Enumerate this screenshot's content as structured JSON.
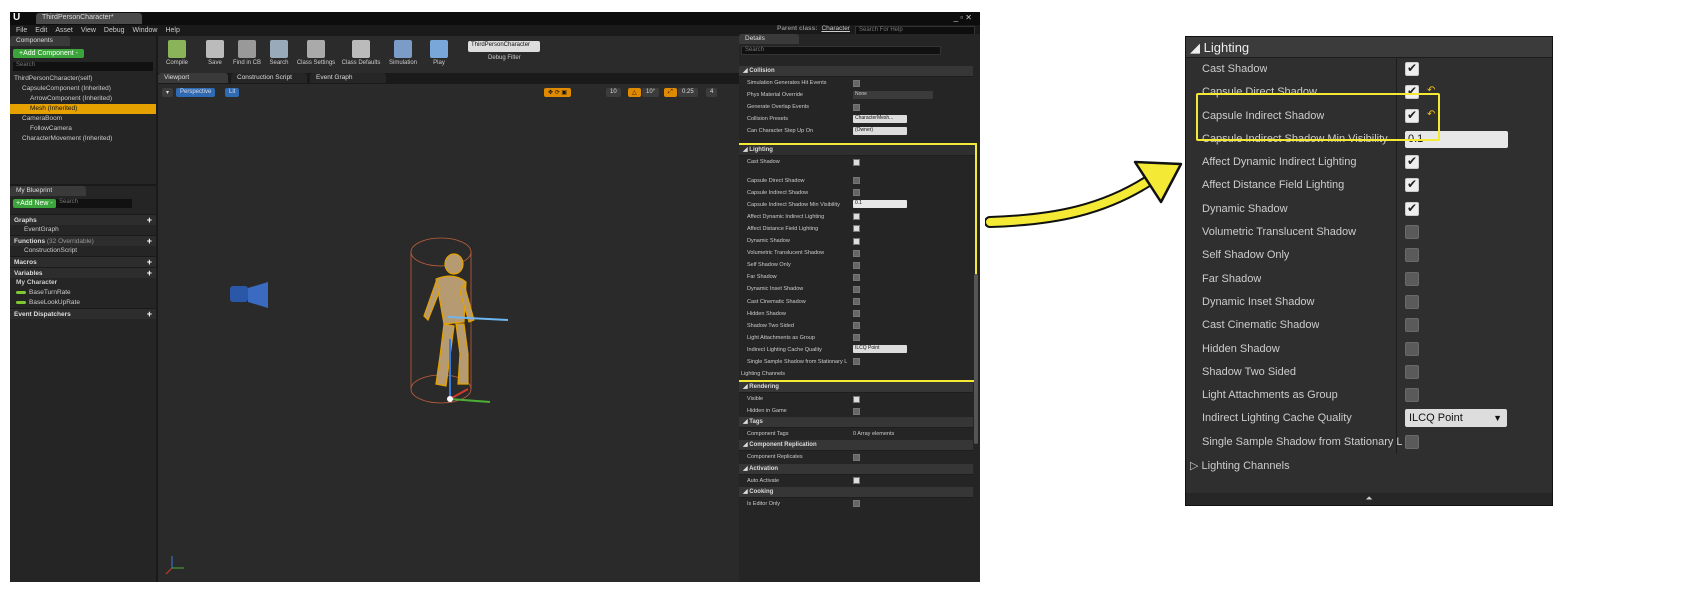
{
  "editor": {
    "logo": "U",
    "doc_tab": "ThirdPersonCharacter*",
    "menu": [
      "File",
      "Edit",
      "Asset",
      "View",
      "Debug",
      "Window",
      "Help"
    ],
    "parent_class_label": "Parent class:",
    "parent_class_value": "Character",
    "search_help_placeholder": "Search For Help"
  },
  "components": {
    "tab": "Components",
    "add_button": "+Add Component -",
    "search_placeholder": "Search",
    "tree": [
      {
        "label": "ThirdPersonCharacter(self)",
        "indent": 0
      },
      {
        "label": "CapsuleComponent (Inherited)",
        "indent": 1
      },
      {
        "label": "ArrowComponent (Inherited)",
        "indent": 2
      },
      {
        "label": "Mesh (Inherited)",
        "indent": 2,
        "selected": true
      },
      {
        "label": "CameraBoom",
        "indent": 1
      },
      {
        "label": "FollowCamera",
        "indent": 2
      },
      {
        "label": "CharacterMovement (Inherited)",
        "indent": 1
      }
    ]
  },
  "blueprint": {
    "tab": "My Blueprint",
    "add_button": "+Add New -",
    "search_placeholder": "Search",
    "graphs": "Graphs",
    "event_graph": "EventGraph",
    "functions": "Functions",
    "functions_note": "(32 Overridable)",
    "construction_script": "ConstructionScript",
    "macros": "Macros",
    "variables": "Variables",
    "my_character": "My Character",
    "var_1": "BaseTurnRate",
    "var_2": "BaseLookUpRate",
    "event_dispatchers": "Event Dispatchers"
  },
  "toolbar": {
    "compile": "Compile",
    "save": "Save",
    "find_in_cb": "Find in CB",
    "search": "Search",
    "class_settings": "Class Settings",
    "class_defaults": "Class Defaults",
    "simulation": "Simulation",
    "play": "Play",
    "debug_object": "ThirdPersonCharacter",
    "debug_filter": "Debug Filter"
  },
  "editor_tabs": [
    "Viewport",
    "Construction Script",
    "Event Graph"
  ],
  "viewport": {
    "perspective": "Perspective",
    "lit": "Lit",
    "grid_snap": "10",
    "rot_snap": "10°",
    "scale_snap": "0.25",
    "cam_speed": "4"
  },
  "details": {
    "tab": "Details",
    "search_placeholder": "Search",
    "collision": {
      "header": "Collision",
      "sim_hit_events": "Simulation Generates Hit Events",
      "phys_material": "Phys Material Override",
      "phys_value": "None",
      "overlap_events": "Generate Overlap Events",
      "presets": "Collision Presets",
      "presets_value": "CharacterMesh...",
      "step_up": "Can Character Step Up On",
      "step_up_value": "(Owner)"
    },
    "lighting_header": "Lighting",
    "lighting_rows": [
      {
        "label": "Cast Shadow",
        "checked": true
      },
      {
        "label": "Capsule Direct Shadow",
        "checked": false
      },
      {
        "label": "Capsule Indirect Shadow",
        "checked": false
      },
      {
        "label": "Capsule Indirect Shadow Min Visibility",
        "value": "0.1"
      },
      {
        "label": "Affect Dynamic Indirect Lighting",
        "checked": true
      },
      {
        "label": "Affect Distance Field Lighting",
        "checked": true
      },
      {
        "label": "Dynamic Shadow",
        "checked": true
      },
      {
        "label": "Volumetric Translucent Shadow",
        "checked": false
      },
      {
        "label": "Self Shadow Only",
        "checked": false
      },
      {
        "label": "Far Shadow",
        "checked": false
      },
      {
        "label": "Dynamic Inset Shadow",
        "checked": false
      },
      {
        "label": "Cast Cinematic Shadow",
        "checked": false
      },
      {
        "label": "Hidden Shadow",
        "checked": false
      },
      {
        "label": "Shadow Two Sided",
        "checked": false
      },
      {
        "label": "Light Attachments as Group",
        "checked": false
      },
      {
        "label": "Indirect Lighting Cache Quality",
        "dropdown": "ILCQ Point"
      },
      {
        "label": "Single Sample Shadow from Stationary L",
        "checked": false
      }
    ],
    "lighting_channels": "Lighting Channels",
    "rendering": {
      "header": "Rendering",
      "visible": "Visible",
      "hidden_in_game": "Hidden in Game"
    },
    "tags": {
      "header": "Tags",
      "component_tags": "Component Tags",
      "value": "0 Array elements"
    },
    "replication": {
      "header": "Component Replication",
      "row": "Component Replicates"
    },
    "activation": {
      "header": "Activation",
      "row": "Auto Activate"
    },
    "cooking": {
      "header": "Cooking",
      "row": "Is Editor Only"
    }
  },
  "zoom": {
    "header": "Lighting",
    "rows": [
      {
        "label": "Cast Shadow",
        "checked": true
      },
      {
        "label": "Capsule Direct Shadow",
        "checked": true,
        "revert": true
      },
      {
        "label": "Capsule Indirect Shadow",
        "checked": true,
        "revert": true
      },
      {
        "label": "Capsule Indirect Shadow Min Visibility",
        "value": "0.1"
      },
      {
        "label": "Affect Dynamic Indirect Lighting",
        "checked": true
      },
      {
        "label": "Affect Distance Field Lighting",
        "checked": true
      },
      {
        "label": "Dynamic Shadow",
        "checked": true
      },
      {
        "label": "Volumetric Translucent Shadow",
        "checked": false
      },
      {
        "label": "Self Shadow Only",
        "checked": false
      },
      {
        "label": "Far Shadow",
        "checked": false
      },
      {
        "label": "Dynamic Inset Shadow",
        "checked": false
      },
      {
        "label": "Cast Cinematic Shadow",
        "checked": false
      },
      {
        "label": "Hidden Shadow",
        "checked": false
      },
      {
        "label": "Shadow Two Sided",
        "checked": false
      },
      {
        "label": "Light Attachments as Group",
        "checked": false
      },
      {
        "label": "Indirect Lighting Cache Quality",
        "dropdown": "ILCQ Point"
      },
      {
        "label": "Single Sample Shadow from Stationary L",
        "checked": false
      }
    ],
    "lighting_channels": "Lighting Channels"
  },
  "colors": {
    "highlight": "#f4ea35",
    "selection": "#e5a100",
    "green_button": "#3ba53b"
  }
}
